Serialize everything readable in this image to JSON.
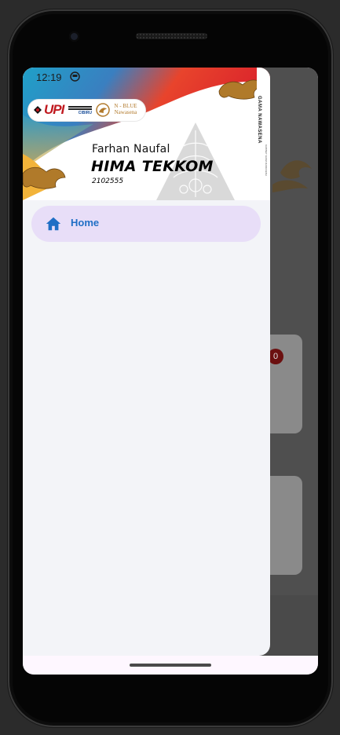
{
  "status_bar": {
    "time": "12:19"
  },
  "drawer": {
    "header": {
      "name": "Farhan Naufal",
      "organization": "HIMA TEKKOM",
      "id_number": "2102555",
      "card_title": "GAMA NAWASENA",
      "card_subtitle": "KABINET GAMA NAWASENA",
      "logos": {
        "upi": "UPI",
        "campus": "CIBIRU",
        "nblue_line1": "N - BLUE",
        "nblue_line2": "Nawasena"
      }
    },
    "menu": {
      "items": [
        {
          "label": "Home",
          "icon": "home-icon",
          "selected": true
        }
      ]
    }
  },
  "background_app": {
    "badge": "0"
  },
  "colors": {
    "drawer_bg": "#f3f4f8",
    "selected_item_bg": "#e8def8",
    "menu_label": "#1f6fc5",
    "scrim": "#4f4f4f"
  }
}
